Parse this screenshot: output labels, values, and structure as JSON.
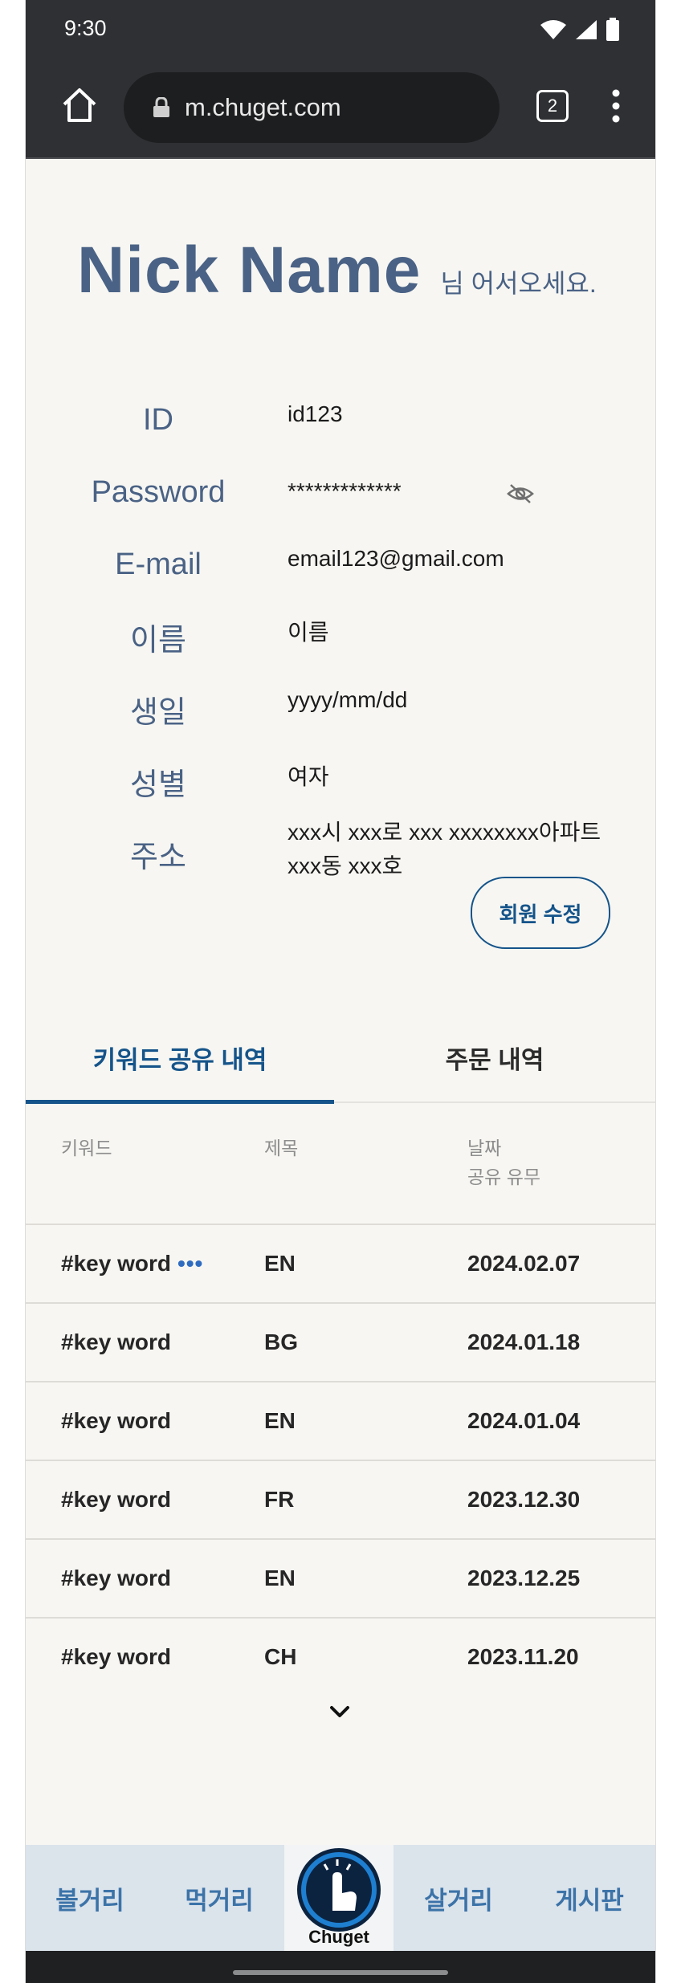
{
  "status": {
    "time": "9:30"
  },
  "browser": {
    "url": "m.chuget.com",
    "tab_count": "2"
  },
  "welcome": {
    "nickname": "Nick Name",
    "suffix": "님 어서오세요."
  },
  "profile": {
    "rows": [
      {
        "label": "ID",
        "value": "id123"
      },
      {
        "label": "Password",
        "value": "*************"
      },
      {
        "label": "E-mail",
        "value": "email123@gmail.com"
      },
      {
        "label": "이름",
        "value": "이름"
      },
      {
        "label": "생일",
        "value": "yyyy/mm/dd"
      },
      {
        "label": "성별",
        "value": "여자"
      },
      {
        "label": "주소",
        "value_line1": "xxx시 xxx로 xxx xxxxxxxx아파트",
        "value_line2": "xxx동 xxx호"
      }
    ],
    "edit_button": "회원 수정"
  },
  "tabs": [
    {
      "label": "키워드 공유 내역",
      "active": true
    },
    {
      "label": "주문 내역",
      "active": false
    }
  ],
  "table": {
    "headers": {
      "keyword": "키워드",
      "title": "제목",
      "date_line1": "날짜",
      "date_line2": "공유 유무"
    },
    "rows": [
      {
        "keyword": "#key word",
        "more": "•••",
        "title": "EN",
        "date": "2024.02.07"
      },
      {
        "keyword": "#key word",
        "title": "BG",
        "date": "2024.01.18"
      },
      {
        "keyword": "#key word",
        "title": "EN",
        "date": "2024.01.04"
      },
      {
        "keyword": "#key word",
        "title": "FR",
        "date": "2023.12.30"
      },
      {
        "keyword": "#key word",
        "title": "EN",
        "date": "2023.12.25"
      },
      {
        "keyword": "#key word",
        "title": "CH",
        "date": "2023.11.20"
      }
    ]
  },
  "bottom_nav": {
    "items": [
      "볼거리",
      "먹거리",
      "살거리",
      "게시판"
    ],
    "logo_text": "Chuget"
  },
  "colors": {
    "accent": "#15548a",
    "label": "#4a6285",
    "nav_text": "#3c73a8"
  },
  "icons": [
    "wifi-icon",
    "signal-icon",
    "battery-icon",
    "home-icon",
    "lock-icon",
    "tabs-icon",
    "menu-icon",
    "eye-off-icon",
    "chevron-down-icon",
    "logo-icon"
  ]
}
